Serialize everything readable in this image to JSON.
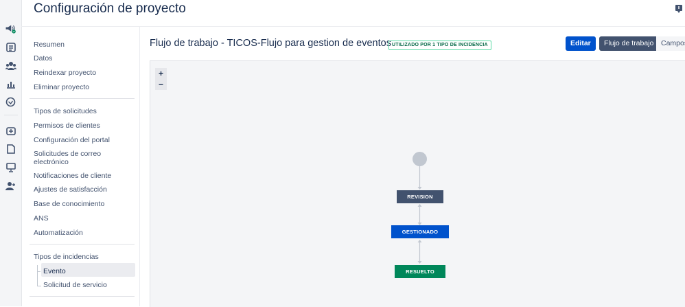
{
  "header": {
    "title": "Configuración de proyecto"
  },
  "rail": {
    "icons": [
      "megaphone-icon",
      "queue-icon",
      "customers-icon",
      "reports-icon",
      "sla-clock-icon",
      "add-issue-icon",
      "page-icon",
      "monitor-icon",
      "add-user-icon"
    ]
  },
  "sidebar": {
    "group1": [
      "Resumen",
      "Datos",
      "Reindexar proyecto",
      "Eliminar proyecto"
    ],
    "group2": [
      "Tipos de solicitudes",
      "Permisos de clientes",
      "Configuración del portal",
      "Solicitudes de correo electrónico",
      "Notificaciones de cliente",
      "Ajustes de satisfacción",
      "Base de conocimiento",
      "ANS",
      "Automatización"
    ],
    "group3_title": "Tipos de incidencias",
    "group3_children": [
      "Evento",
      "Solicitud de servicio"
    ],
    "selected": "Evento"
  },
  "main": {
    "workflow_title": "Flujo de trabajo - TICOS-Flujo para gestion de eventos",
    "usage_lozenge": "UTILIZADO POR 1 TIPO DE INCIDENCIA",
    "edit_button": "Editar",
    "workflow_button": "Flujo de trabajo",
    "fields_button": "Campos",
    "zoom_in": "+",
    "zoom_out": "−"
  },
  "diagram": {
    "statuses": [
      {
        "name": "REVISION",
        "color": "#42526e"
      },
      {
        "name": "GESTIONADO",
        "color": "#0052cc"
      },
      {
        "name": "RESUELTO",
        "color": "#00875a"
      }
    ]
  }
}
